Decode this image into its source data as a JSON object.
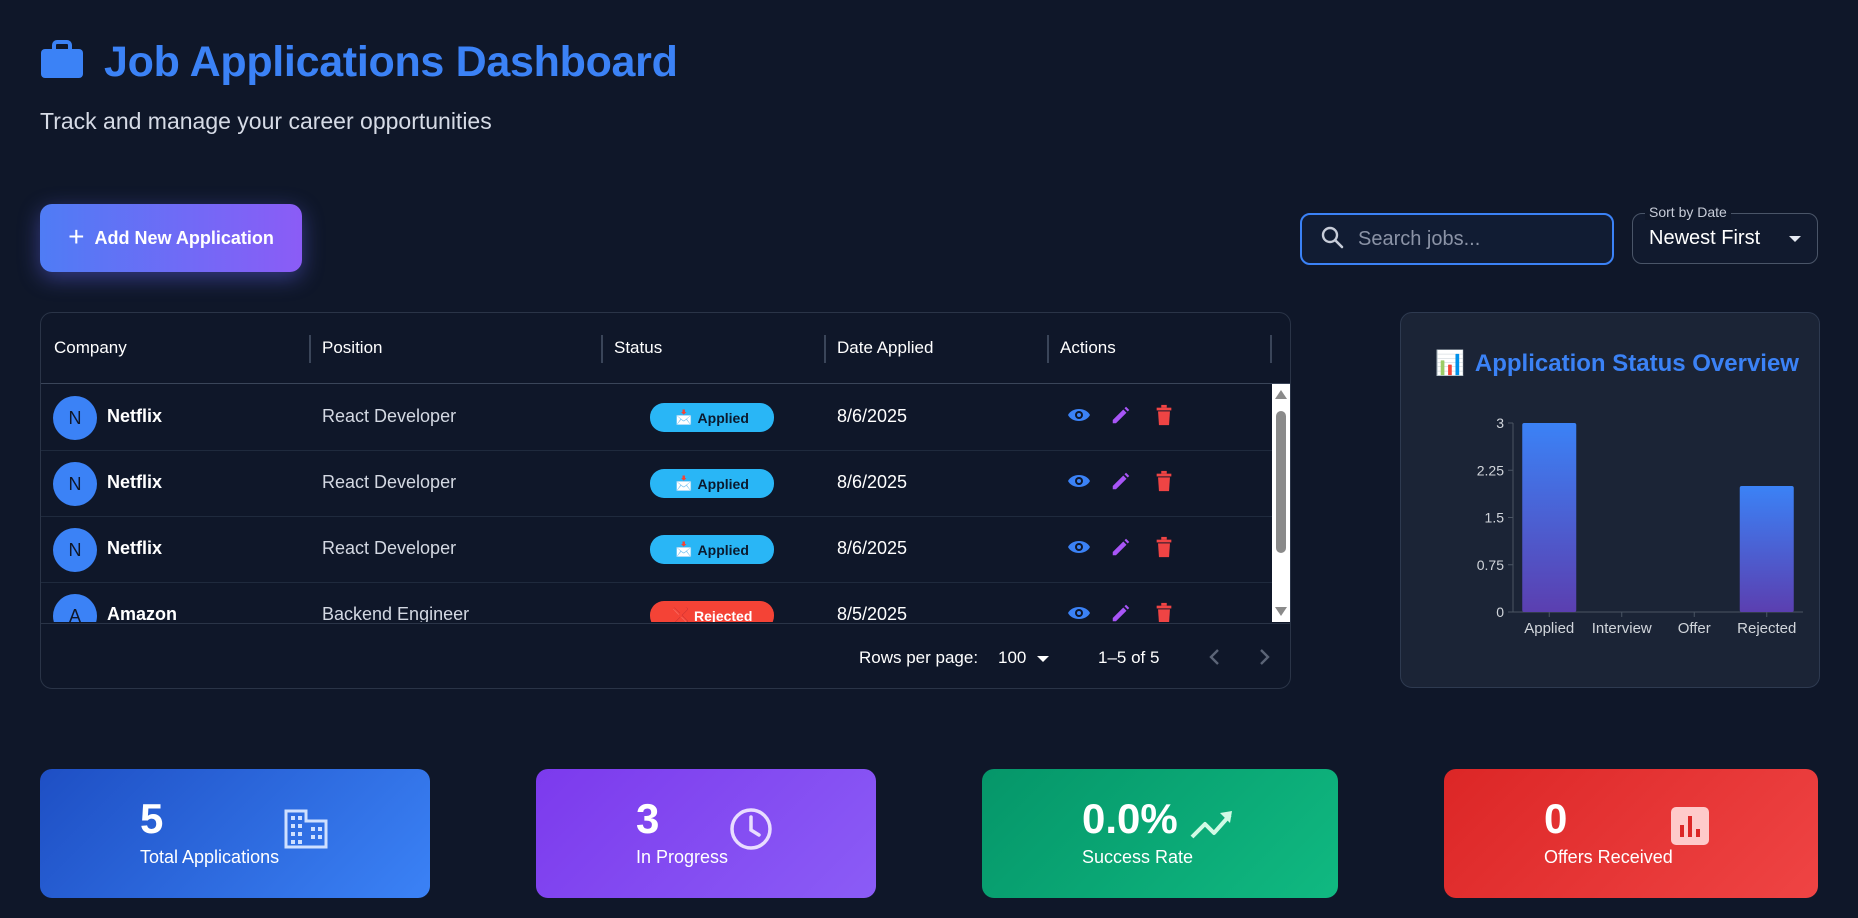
{
  "header": {
    "title": "Job Applications Dashboard",
    "subtitle": "Track and manage your career opportunities",
    "icon": "briefcase-icon"
  },
  "toolbar": {
    "add_button_label": "Add New Application",
    "search_placeholder": "Search jobs...",
    "sort_label": "Sort by Date",
    "sort_value": "Newest First"
  },
  "table": {
    "columns": [
      "Company",
      "Position",
      "Status",
      "Date Applied",
      "Actions"
    ],
    "rows": [
      {
        "initial": "N",
        "company": "Netflix",
        "position": "React Developer",
        "status": "Applied",
        "status_icon": "📩",
        "date": "8/6/2025"
      },
      {
        "initial": "N",
        "company": "Netflix",
        "position": "React Developer",
        "status": "Applied",
        "status_icon": "📩",
        "date": "8/6/2025"
      },
      {
        "initial": "N",
        "company": "Netflix",
        "position": "React Developer",
        "status": "Applied",
        "status_icon": "📩",
        "date": "8/6/2025"
      },
      {
        "initial": "A",
        "company": "Amazon",
        "position": "Backend Engineer",
        "status": "Rejected",
        "status_icon": "❌",
        "date": "8/5/2025"
      }
    ],
    "pagination": {
      "rows_per_page_label": "Rows per page:",
      "rows_per_page_value": "100",
      "range": "1–5 of 5"
    }
  },
  "chart": {
    "title": "Application Status Overview",
    "title_icon": "📊"
  },
  "chart_data": {
    "type": "bar",
    "categories": [
      "Applied",
      "Interview",
      "Offer",
      "Rejected"
    ],
    "values": [
      3,
      0,
      0,
      2
    ],
    "ylim": [
      0,
      3
    ],
    "yticks": [
      "0",
      "0.75",
      "1.5",
      "2.25",
      "3"
    ],
    "xlabel": "",
    "ylabel": "",
    "grid": false,
    "colors": {
      "top": "#3b82f6",
      "bottom": "#5b3fb0"
    }
  },
  "stats": [
    {
      "value": "5",
      "label": "Total Applications",
      "icon": "building-icon",
      "gradient": [
        "#1e4fc4",
        "#3b82f6"
      ]
    },
    {
      "value": "3",
      "label": "In Progress",
      "icon": "clock-icon",
      "gradient": [
        "#7c3aed",
        "#8b5cf6"
      ]
    },
    {
      "value": "0.0%",
      "label": "Success Rate",
      "icon": "trending-up-icon",
      "gradient": [
        "#059669",
        "#10b981"
      ]
    },
    {
      "value": "0",
      "label": "Offers Received",
      "icon": "bar-chart-icon",
      "gradient": [
        "#dc2626",
        "#ef4444"
      ]
    }
  ]
}
